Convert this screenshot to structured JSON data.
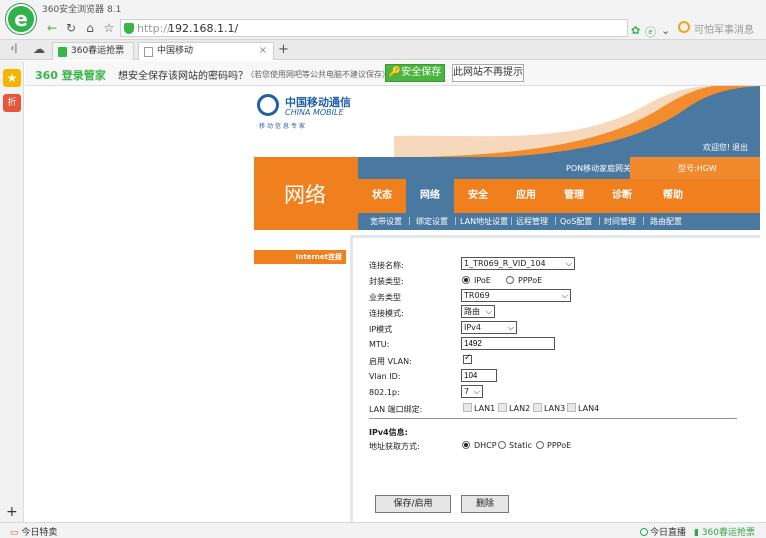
{
  "browser": {
    "title": "360安全浏览器 8.1",
    "logo_letter": "e",
    "url_scheme": "http://",
    "url_host": "192.168.1.1/",
    "search_placeholder": "可怕军事消息",
    "nav_icons": [
      "back-icon",
      "forward-icon",
      "refresh-icon",
      "home-icon",
      "star-icon"
    ],
    "tabs": [
      {
        "label": "360春运抢票",
        "active": false
      },
      {
        "label": "中国移动",
        "active": true
      }
    ],
    "new_tab": "+",
    "tab_close": "×"
  },
  "password_bar": {
    "brand": "360 登录管家",
    "question": "想安全保存该网站的密码吗？",
    "note": "（若您使用网吧等公共电脑不建议保存）",
    "save_label": "安全保存",
    "dont_label": "此网站不再提示"
  },
  "sidebar": {
    "plus": "+",
    "gift_label": "折"
  },
  "router": {
    "logo_cn": "中国移动通信",
    "logo_en": "CHINA MOBILE",
    "logo_sub": "移动信息专家",
    "welcome": "欢迎您!",
    "logout": "退出",
    "section_title": "网络",
    "pon": "PON移动家庭网关",
    "model": "型号:HGW",
    "menu": [
      "状态",
      "网络",
      "安全",
      "应用",
      "管理",
      "诊断",
      "帮助"
    ],
    "submenu": [
      "宽带设置",
      "绑定设置",
      "LAN地址设置",
      "远程管理",
      "QoS配置",
      "时间管理",
      "路由配置"
    ],
    "side_label": "Internet连接",
    "form": {
      "conn_name_label": "连接名称:",
      "conn_name_value": "1_TR069_R_VID_104",
      "encap_label": "封装类型:",
      "encap_ipoe": "IPoE",
      "encap_pppoe": "PPPoE",
      "service_label": "业务类型",
      "service_value": "TR069",
      "mode_label": "连接模式:",
      "mode_value": "路由",
      "ip_mode_label": "IP模式",
      "ip_mode_value": "IPv4",
      "mtu_label": "MTU:",
      "mtu_value": "1492",
      "vlan_enable_label": "启用 VLAN:",
      "vlan_id_label": "Vlan ID:",
      "vlan_id_value": "104",
      "dot1p_label": "802.1p:",
      "dot1p_value": "7",
      "lan_bind_label": "LAN 端口绑定:",
      "lan_ports": [
        "LAN1",
        "LAN2",
        "LAN3",
        "LAN4"
      ],
      "ipv4_info": "IPv4信息:",
      "addr_mode_label": "地址获取方式:",
      "addr_dhcp": "DHCP",
      "addr_static": "Static",
      "addr_pppoe": "PPPoE",
      "save_btn": "保存/启用",
      "delete_btn": "删除"
    }
  },
  "statusbar": {
    "left": "今日特卖",
    "live": "今日直播",
    "tickets": "360春运抢票"
  },
  "colors": {
    "orange": "#f07f1e",
    "blue": "#4978a0",
    "green": "#3ab54a"
  }
}
